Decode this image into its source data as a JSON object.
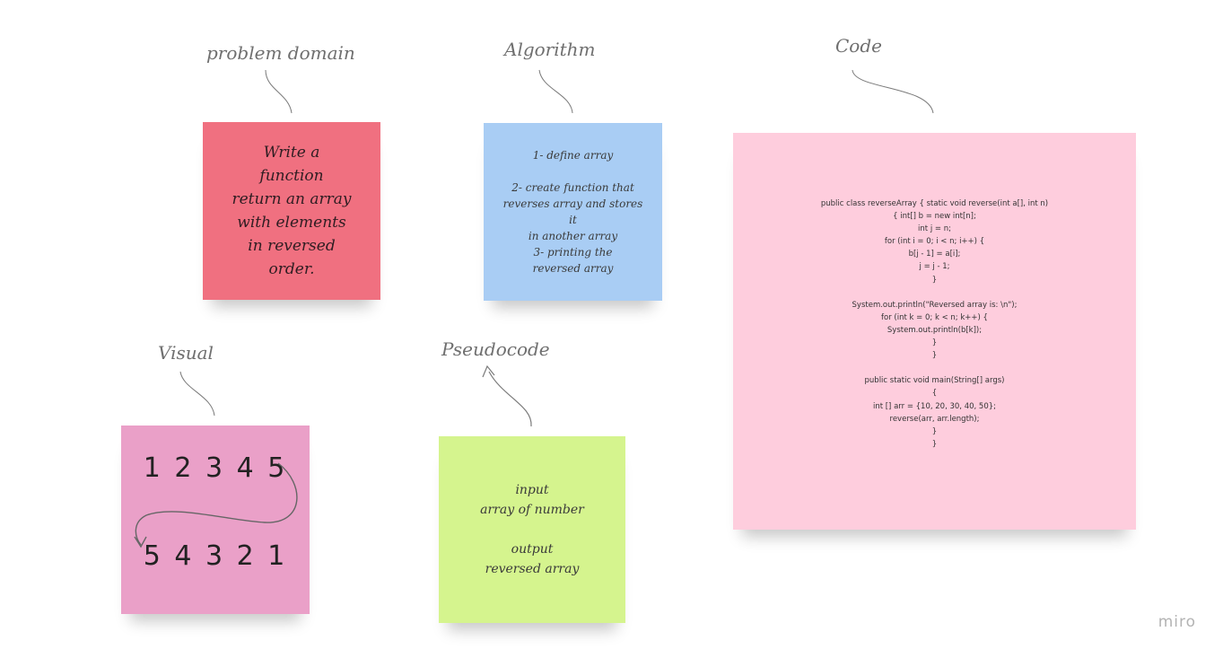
{
  "labels": {
    "problem_domain": "problem domain",
    "algorithm": "Algorithm",
    "code": "Code",
    "visual": "Visual",
    "pseudocode": "Pseudocode"
  },
  "notes": {
    "problem": {
      "color": "#f07080",
      "lines": [
        "Write a",
        "function",
        "return an array",
        "with elements",
        "in reversed",
        "order."
      ]
    },
    "algorithm": {
      "color": "#a9cdf4",
      "lines": [
        "1- define array",
        "",
        "2- create function that",
        "reverses array and stores",
        "it",
        "in another array",
        "3- printing the",
        "reversed array"
      ]
    },
    "visual": {
      "color": "#eaa0c8",
      "top": "1 2 3 4 5",
      "bottom": "5 4 3 2 1"
    },
    "pseudocode": {
      "color": "#d5f48e",
      "lines": [
        "input",
        "array of number",
        "",
        "output",
        "reversed array"
      ]
    },
    "code": {
      "color": "#fecddd",
      "lines": [
        "public class reverseArray { static void reverse(int a[], int n)",
        "{ int[] b = new int[n];",
        "int j = n;",
        "for (int i = 0; i < n; i++) {",
        "b[j - 1] = a[i];",
        "j = j - 1;",
        "}",
        "",
        "System.out.println(\"Reversed array is: \\n\");",
        "for (int k = 0; k < n; k++) {",
        "System.out.println(b[k]);",
        "}",
        "}",
        "",
        "public static void main(String[] args)",
        "{",
        "int [] arr = {10, 20, 30, 40, 50};",
        "reverse(arr, arr.length);",
        "}",
        "}"
      ]
    }
  },
  "watermark": "miro",
  "colors": {
    "connector": "#7a7a7a",
    "label": "#6f6f6f"
  }
}
